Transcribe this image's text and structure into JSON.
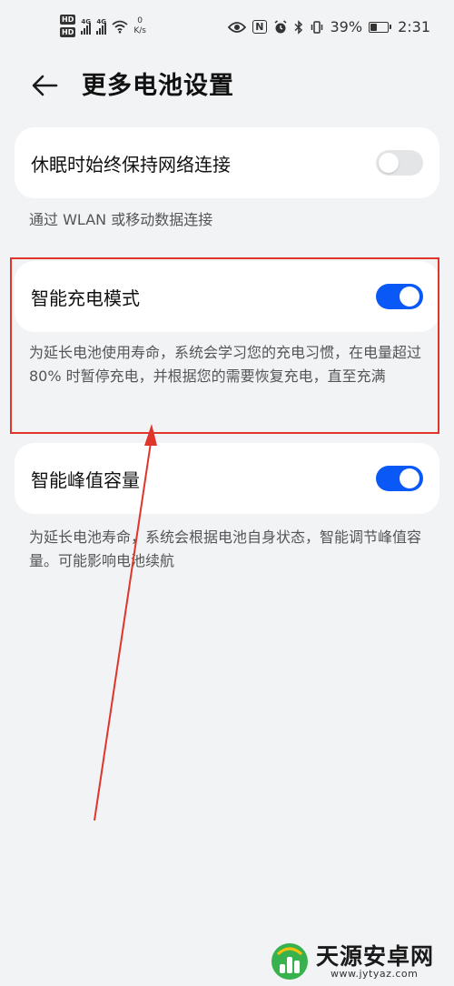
{
  "status_bar": {
    "hd1": "HD",
    "hd2": "HD",
    "net1": "4G",
    "net2": "4G",
    "speed_value": "0",
    "speed_unit": "K/s",
    "nfc": "N",
    "battery_text": "39%",
    "battery_level": 0.39,
    "time": "2:31"
  },
  "header": {
    "title": "更多电池设置"
  },
  "settings": [
    {
      "label": "休眠时始终保持网络连接",
      "enabled": false,
      "description": "通过 WLAN 或移动数据连接"
    },
    {
      "label": "智能充电模式",
      "enabled": true,
      "description": "为延长电池使用寿命，系统会学习您的充电习惯，在电量超过 80% 时暂停充电，并根据您的需要恢复充电，直至充满"
    },
    {
      "label": "智能峰值容量",
      "enabled": true,
      "description": "为延长电池寿命，系统会根据电池自身状态，智能调节峰值容量。可能影响电池续航"
    }
  ],
  "colors": {
    "accent": "#0a59f7",
    "background": "#f1f3f5",
    "annotation": "#e0352b"
  },
  "watermark": {
    "name": "天源安卓网",
    "url": "www.jytyaz.com"
  }
}
